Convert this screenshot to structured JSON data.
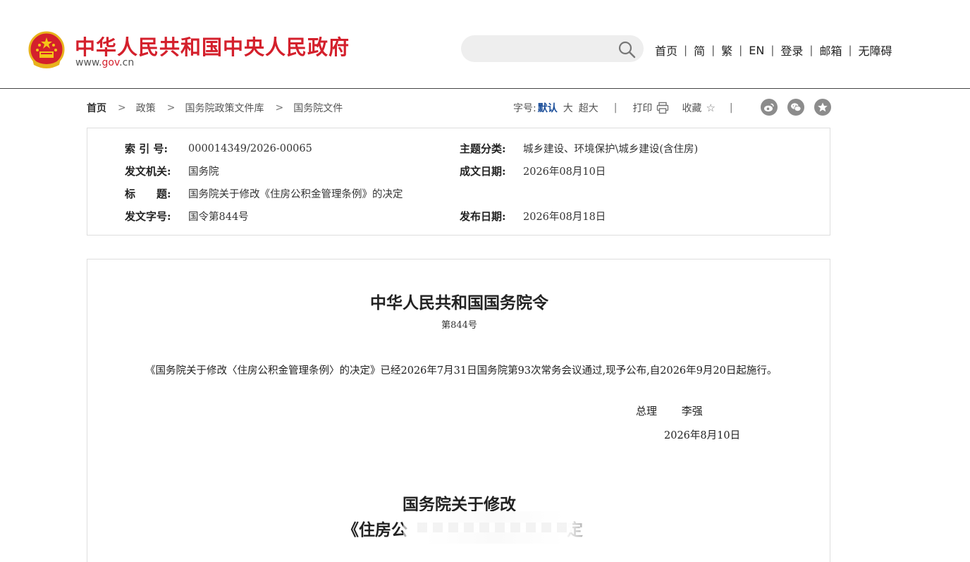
{
  "header": {
    "site_title": "中华人民共和国中央人民政府",
    "domain_prefix": "www.",
    "domain_gov": "gov",
    "domain_suffix": ".cn",
    "search_placeholder": "",
    "nav": [
      "首页",
      "简",
      "繁",
      "EN",
      "登录",
      "邮箱",
      "无障碍"
    ],
    "nav_separator": "|"
  },
  "breadcrumb": {
    "items": [
      "首页",
      "政策",
      "国务院政策文件库",
      "国务院文件"
    ],
    "separator": ">"
  },
  "tools": {
    "font_label": "字号:",
    "font_default": "默认",
    "font_large": "大",
    "font_xlarge": "超大",
    "divider": "|",
    "print": "打印",
    "favorite": "收藏",
    "share_icons": [
      "weibo-icon",
      "wechat-icon",
      "favorite-star-icon"
    ]
  },
  "meta": {
    "index_no_label": "索 引 号:",
    "index_no": "000014349/2026-00065",
    "topic_label": "主题分类:",
    "topic": "城乡建设、环境保护\\城乡建设(含住房)",
    "issuer_label": "发文机关:",
    "issuer": "国务院",
    "written_date_label": "成文日期:",
    "written_date": "2026年08月10日",
    "title_label": "标　　题:",
    "title": "国务院关于修改《住房公积金管理条例》的决定",
    "doc_no_label": "发文字号:",
    "doc_no": "国令第844号",
    "publish_date_label": "发布日期:",
    "publish_date": "2026年08月18日"
  },
  "content": {
    "order_title": "中华人民共和国国务院令",
    "order_number": "第844号",
    "paragraph": "《国务院关于修改〈住房公积金管理条例〉的决定》已经2026年7月31日国务院第93次常务会议通过,现予公布,自2026年9月20日起施行。",
    "signer_title": "总理",
    "signer_name": "李强",
    "sign_date": "2026年8月10日",
    "decision_title": "国务院关于修改",
    "decision_sub_visible": "《住房公",
    "decision_sub_tail": "定"
  },
  "colors": {
    "brand_red": "#d4202c",
    "link_blue": "#1a4d99",
    "icon_gray": "#8c8c8c"
  }
}
